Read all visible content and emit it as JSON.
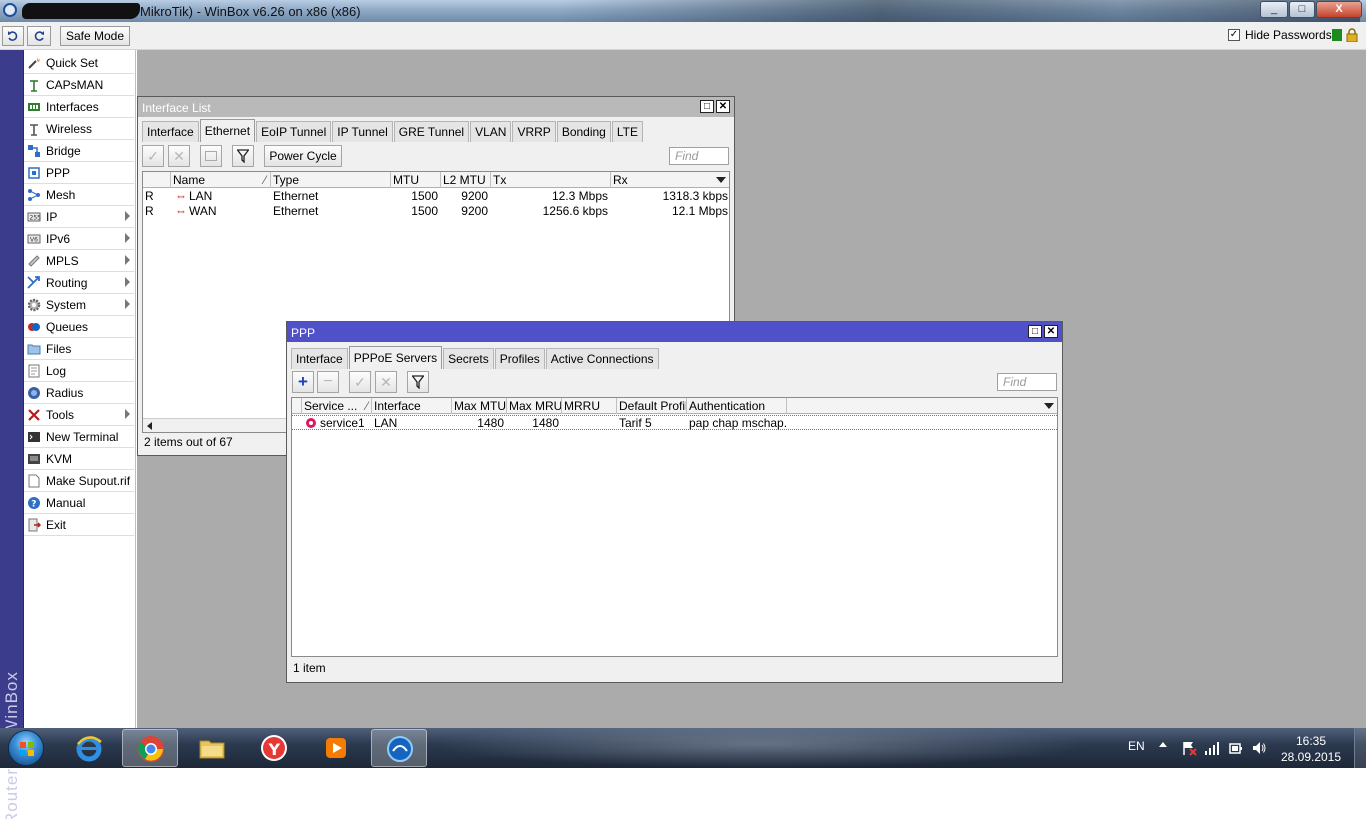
{
  "window": {
    "title": "MikroTik) - WinBox v6.26 on x86 (x86)",
    "btn_min": "_",
    "btn_max": "□",
    "btn_close": "X"
  },
  "toolbar": {
    "safe_mode": "Safe Mode",
    "hide_passwords": "Hide Passwords",
    "hide_passwords_checked": "✓"
  },
  "brand": "RouterOS WinBox",
  "sidebar": {
    "items": [
      {
        "label": "Quick Set",
        "icon": "wand-icon"
      },
      {
        "label": "CAPsMAN",
        "icon": "antenna-icon"
      },
      {
        "label": "Interfaces",
        "icon": "interfaces-icon"
      },
      {
        "label": "Wireless",
        "icon": "wireless-icon"
      },
      {
        "label": "Bridge",
        "icon": "bridge-icon"
      },
      {
        "label": "PPP",
        "icon": "ppp-icon"
      },
      {
        "label": "Mesh",
        "icon": "mesh-icon"
      },
      {
        "label": "IP",
        "icon": "ip-icon"
      },
      {
        "label": "IPv6",
        "icon": "ipv6-icon"
      },
      {
        "label": "MPLS",
        "icon": "mpls-icon"
      },
      {
        "label": "Routing",
        "icon": "routing-icon"
      },
      {
        "label": "System",
        "icon": "gear-icon"
      },
      {
        "label": "Queues",
        "icon": "queues-icon"
      },
      {
        "label": "Files",
        "icon": "folder-icon"
      },
      {
        "label": "Log",
        "icon": "log-icon"
      },
      {
        "label": "Radius",
        "icon": "radius-icon"
      },
      {
        "label": "Tools",
        "icon": "tools-icon"
      },
      {
        "label": "New Terminal",
        "icon": "terminal-icon"
      },
      {
        "label": "KVM",
        "icon": "kvm-icon"
      },
      {
        "label": "Make Supout.rif",
        "icon": "document-icon"
      },
      {
        "label": "Manual",
        "icon": "help-icon"
      },
      {
        "label": "Exit",
        "icon": "exit-icon"
      }
    ]
  },
  "interface_list": {
    "title": "Interface List",
    "tabs": [
      "Interface",
      "Ethernet",
      "EoIP Tunnel",
      "IP Tunnel",
      "GRE Tunnel",
      "VLAN",
      "VRRP",
      "Bonding",
      "LTE"
    ],
    "power_cycle": "Power Cycle",
    "find_placeholder": "Find",
    "columns": [
      "Name",
      "Type",
      "MTU",
      "L2 MTU",
      "Tx",
      "Rx"
    ],
    "rows": [
      {
        "flag": "R",
        "name": "LAN",
        "type": "Ethernet",
        "mtu": "1500",
        "l2mtu": "9200",
        "tx": "12.3 Mbps",
        "rx": "1318.3 kbps"
      },
      {
        "flag": "R",
        "name": "WAN",
        "type": "Ethernet",
        "mtu": "1500",
        "l2mtu": "9200",
        "tx": "1256.6 kbps",
        "rx": "12.1 Mbps"
      }
    ],
    "status": "2 items out of 67"
  },
  "ppp": {
    "title": "PPP",
    "tabs": [
      "Interface",
      "PPPoE Servers",
      "Secrets",
      "Profiles",
      "Active Connections"
    ],
    "find_placeholder": "Find",
    "columns": [
      "Service ...",
      "Interface",
      "Max MTU",
      "Max MRU",
      "MRRU",
      "Default Profile",
      "Authentication"
    ],
    "rows": [
      {
        "service": "service1",
        "interface": "LAN",
        "max_mtu": "1480",
        "max_mru": "1480",
        "mrru": "",
        "profile": "Tarif 5",
        "auth": "pap chap mschap..."
      }
    ],
    "status": "1 item"
  },
  "taskbar": {
    "lang": "EN",
    "time": "16:35",
    "date": "28.09.2015"
  }
}
